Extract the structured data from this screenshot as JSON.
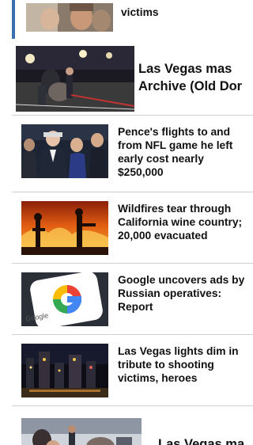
{
  "feed": {
    "items": [
      {
        "title": "victims"
      },
      {
        "title_line1": "Las Vegas mas",
        "title_line2": "Archive (Old Dor"
      },
      {
        "title": "Pence's flights to and from NFL game he left early cost nearly $250,000"
      },
      {
        "title": "Wildfires tear through California wine country; 20,000 evacuated"
      },
      {
        "title": "Google uncovers ads by Russian operatives: Report"
      },
      {
        "title": "Las Vegas lights dim in tribute to shooting victims, heroes"
      },
      {
        "title": "Las Vegas ma"
      }
    ]
  },
  "thumbs": {
    "google_logo_text": "Google"
  },
  "colors": {
    "accent": "#3a6fb0",
    "divider": "#cfcfcf"
  }
}
